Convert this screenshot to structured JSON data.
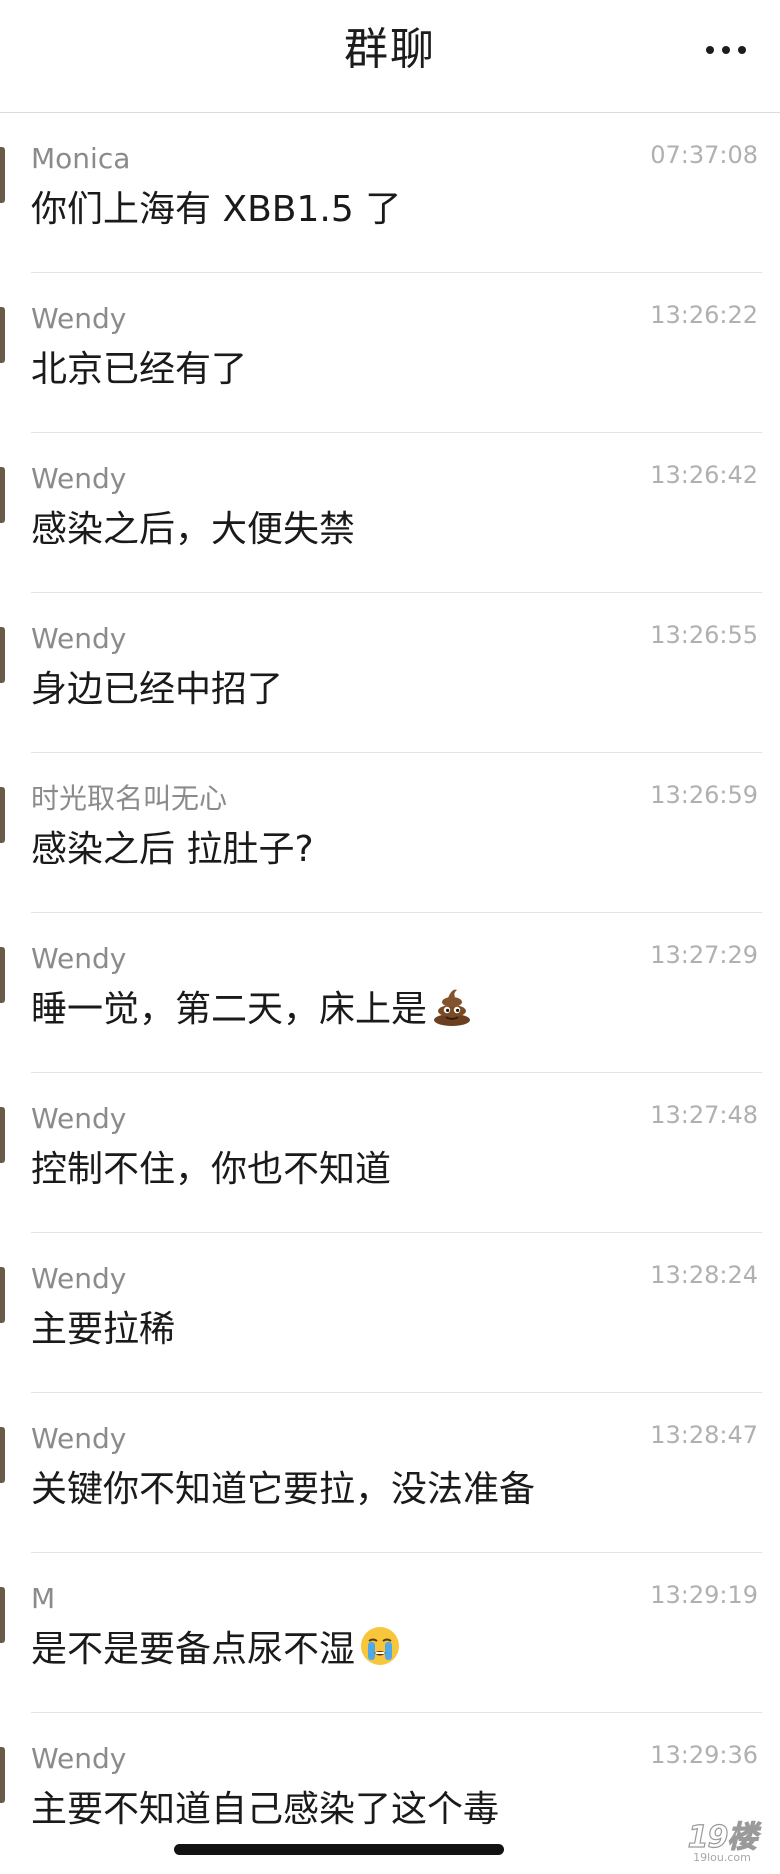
{
  "header": {
    "title": "群聊",
    "more_icon": "more-dots-icon"
  },
  "messages": [
    {
      "sender": "Monica",
      "time": "07:37:08",
      "text": "你们上海有 XBB1.5 了",
      "emoji": ""
    },
    {
      "sender": "Wendy",
      "time": "13:26:22",
      "text": "北京已经有了",
      "emoji": ""
    },
    {
      "sender": "Wendy",
      "time": "13:26:42",
      "text": "感染之后，大便失禁",
      "emoji": ""
    },
    {
      "sender": "Wendy",
      "time": "13:26:55",
      "text": "身边已经中招了",
      "emoji": ""
    },
    {
      "sender": "时光取名叫无心",
      "time": "13:26:59",
      "text": "感染之后 拉肚子?",
      "emoji": ""
    },
    {
      "sender": "Wendy",
      "time": "13:27:29",
      "text": "睡一觉，第二天，床上是",
      "emoji": "pile-of-poo-emoji"
    },
    {
      "sender": "Wendy",
      "time": "13:27:48",
      "text": "控制不住，你也不知道",
      "emoji": ""
    },
    {
      "sender": "Wendy",
      "time": "13:28:24",
      "text": "主要拉稀",
      "emoji": ""
    },
    {
      "sender": "Wendy",
      "time": "13:28:47",
      "text": "关键你不知道它要拉，没法准备",
      "emoji": ""
    },
    {
      "sender": "M",
      "time": "13:29:19",
      "text": "是不是要备点尿不湿",
      "emoji": "crying-face-emoji"
    },
    {
      "sender": "Wendy",
      "time": "13:29:36",
      "text": "主要不知道自己感染了这个毒",
      "emoji": ""
    }
  ],
  "watermark": {
    "text": "19楼",
    "subtext": "19lou.com"
  },
  "colors": {
    "sender": "#8b8b8b",
    "time": "#b0b0b0",
    "content": "#1a1a1a",
    "separator": "#e3e3e3"
  }
}
